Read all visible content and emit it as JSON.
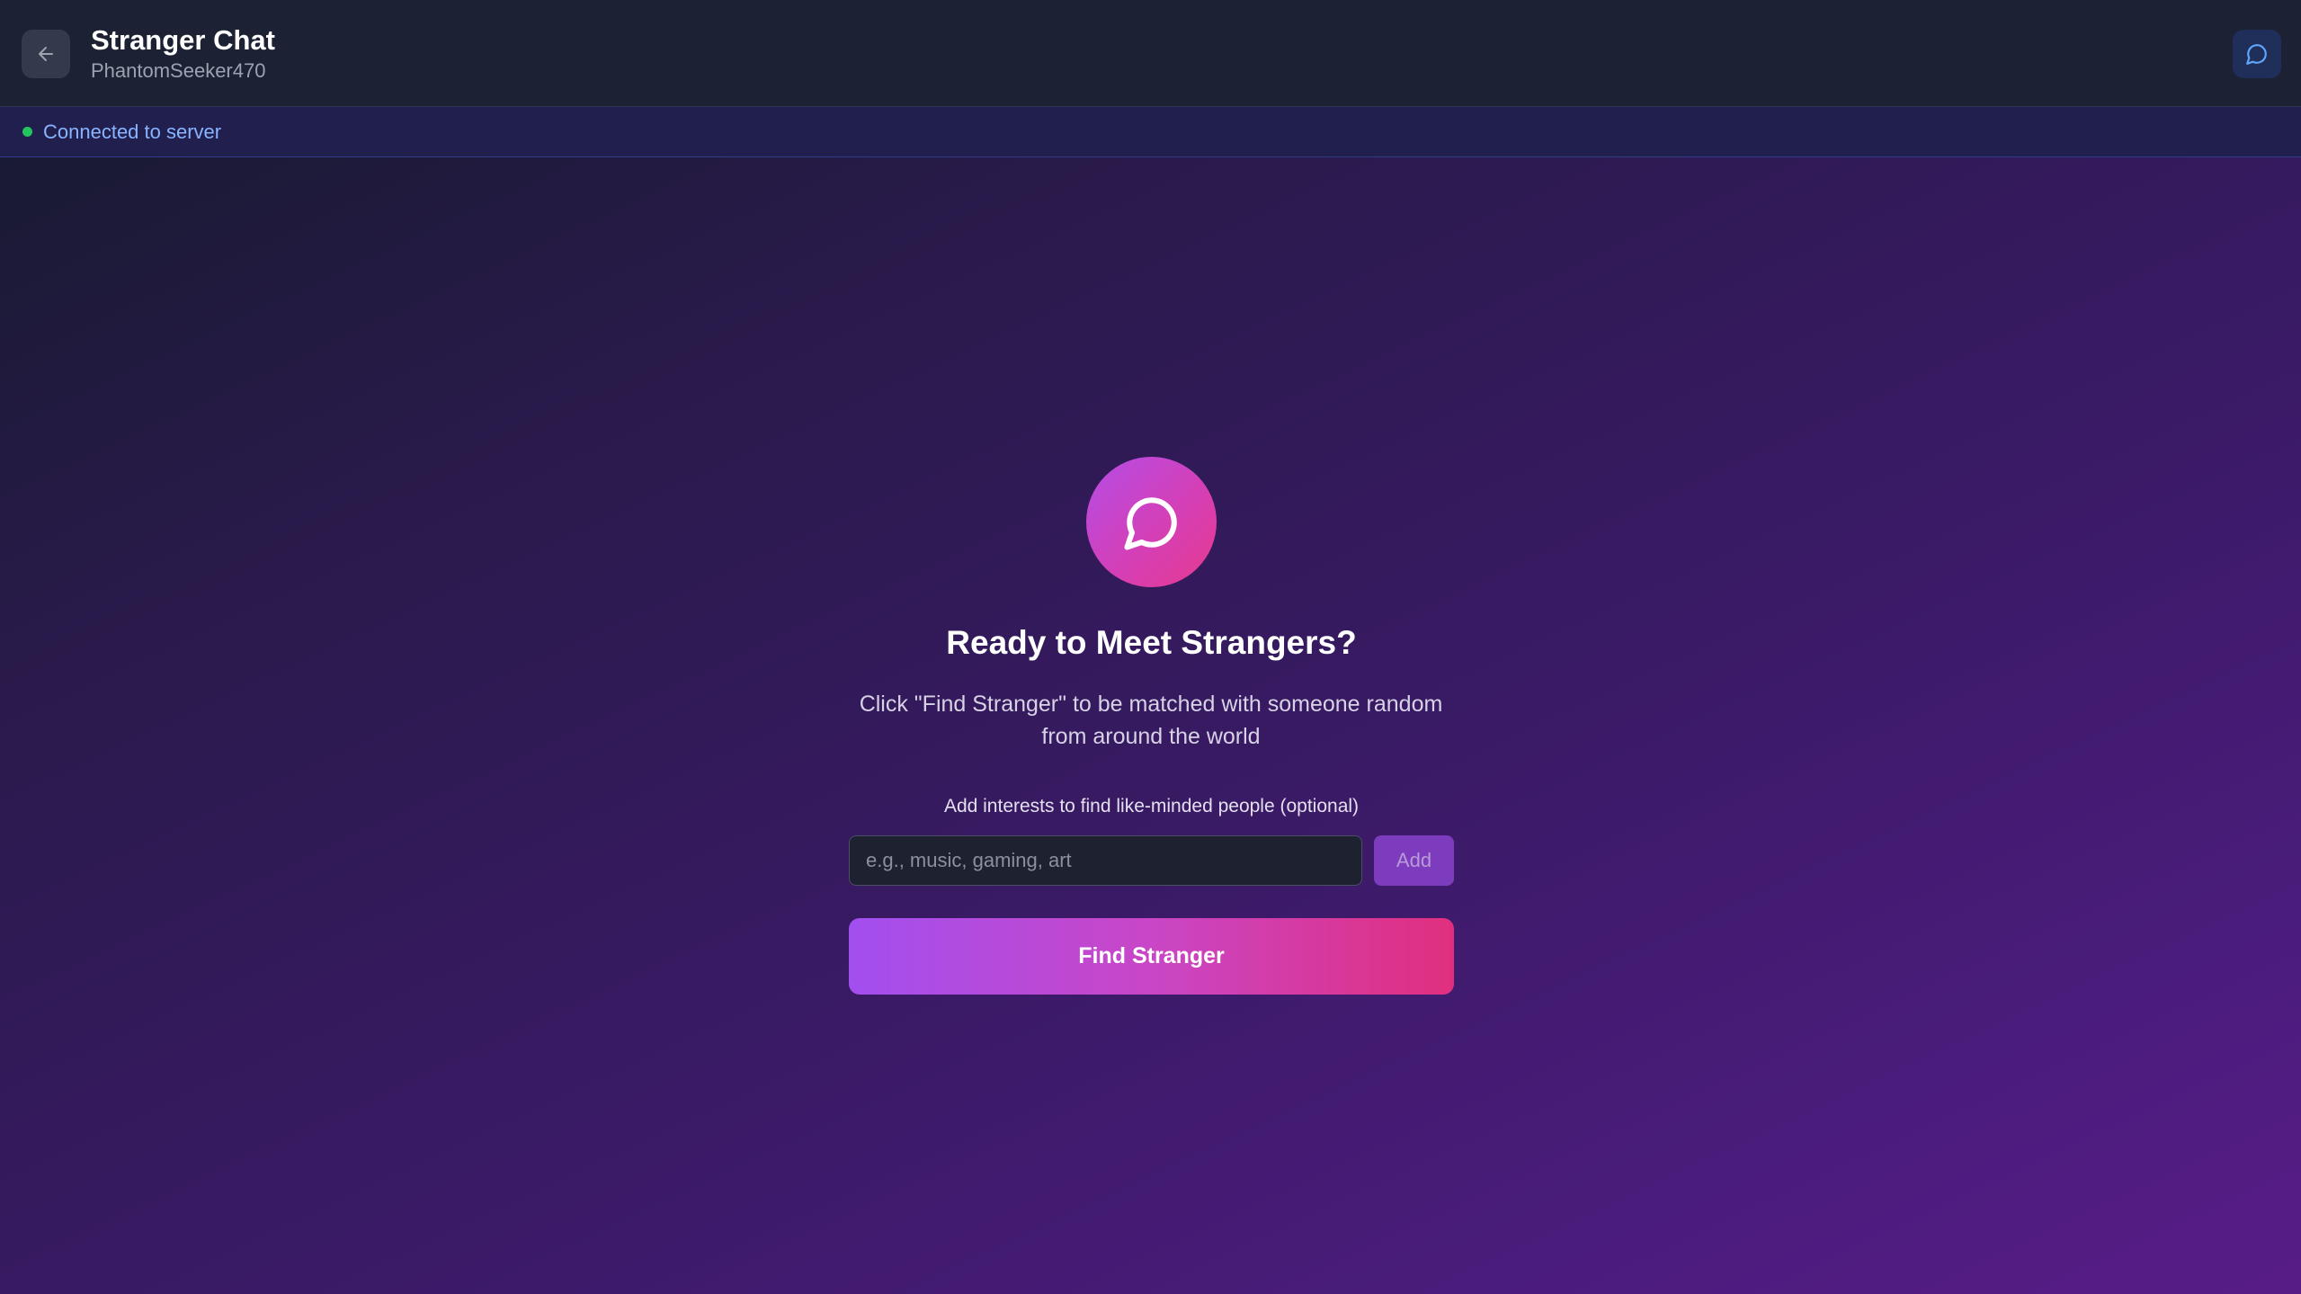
{
  "header": {
    "title": "Stranger Chat",
    "username": "PhantomSeeker470",
    "back_icon": "arrow-left-icon",
    "chat_icon": "message-circle-icon"
  },
  "status": {
    "text": "Connected to server",
    "color": "#22c55e"
  },
  "main": {
    "hero_icon": "message-circle-icon",
    "headline": "Ready to Meet Strangers?",
    "subtitle": "Click \"Find Stranger\" to be matched with someone random from around the world",
    "interest_label": "Add interests to find like-minded people (optional)",
    "interest_placeholder": "e.g., music, gaming, art",
    "interest_value": "",
    "add_label": "Add",
    "find_label": "Find Stranger"
  },
  "colors": {
    "accent_start": "#a855f7",
    "accent_end": "#db2777"
  }
}
